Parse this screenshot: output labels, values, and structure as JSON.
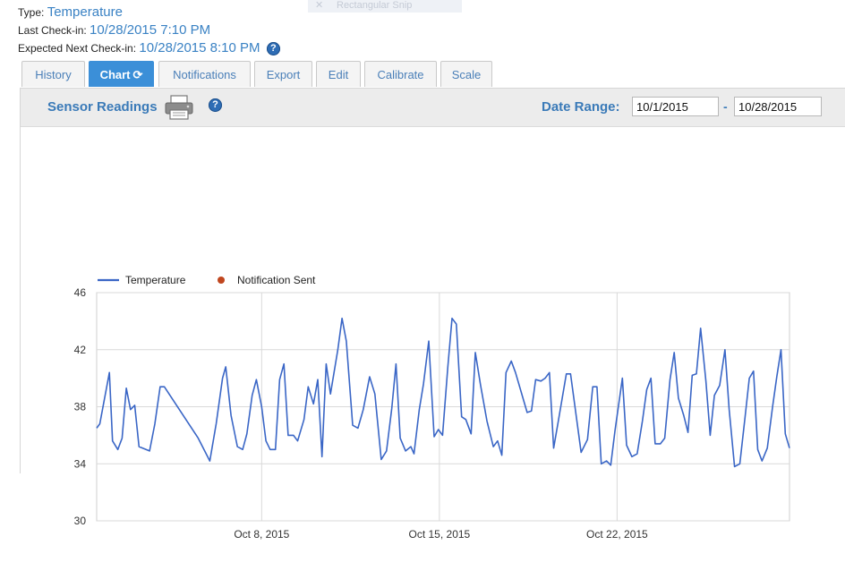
{
  "overlay": {
    "snip_label": "Rectangular Snip"
  },
  "sensor": {
    "type_label": "Type:",
    "type_value": "Temperature",
    "last_checkin_label": "Last Check-in:",
    "last_checkin_value": "10/28/2015 7:10 PM",
    "next_checkin_label": "Expected Next Check-in:",
    "next_checkin_value": "10/28/2015 8:10 PM"
  },
  "tabs": [
    {
      "label": "History"
    },
    {
      "label": "Chart",
      "active": true
    },
    {
      "label": "Notifications"
    },
    {
      "label": "Export"
    },
    {
      "label": "Edit"
    },
    {
      "label": "Calibrate"
    },
    {
      "label": "Scale"
    }
  ],
  "panel": {
    "title": "Sensor Readings",
    "date_range_label": "Date Range:",
    "date_from": "10/1/2015",
    "date_to": "10/28/2015",
    "dash": "-"
  },
  "icons": {
    "help": "help-icon",
    "refresh": "refresh-icon",
    "printer": "printer-icon"
  },
  "colors": {
    "series": "#3a66c6",
    "notification": "#c0461e",
    "link": "#3a82c4",
    "tab_active": "#3b8fd8"
  },
  "chart_data": {
    "type": "line",
    "x_type": "date",
    "x_ticks": [
      "Oct 8, 2015",
      "Oct 15, 2015",
      "Oct 22, 2015"
    ],
    "x_tick_dates": [
      "2015-10-08",
      "2015-10-15",
      "2015-10-22"
    ],
    "xlim": [
      "2015-10-01 12:00",
      "2015-10-28 19:00"
    ],
    "yticks": [
      30,
      34,
      38,
      42,
      46
    ],
    "ylim": [
      30,
      46
    ],
    "grid": true,
    "legend": "top-left",
    "series": [
      {
        "name": "Temperature",
        "points": [
          [
            "2015-10-01 12:00",
            36.5
          ],
          [
            "2015-10-01 15:00",
            36.8
          ],
          [
            "2015-10-02 00:00",
            40.4
          ],
          [
            "2015-10-02 03:00",
            35.6
          ],
          [
            "2015-10-02 08:00",
            35.0
          ],
          [
            "2015-10-02 12:00",
            35.8
          ],
          [
            "2015-10-02 16:00",
            39.3
          ],
          [
            "2015-10-02 20:00",
            37.8
          ],
          [
            "2015-10-03 00:00",
            38.1
          ],
          [
            "2015-10-03 04:00",
            35.2
          ],
          [
            "2015-10-03 14:00",
            34.9
          ],
          [
            "2015-10-03 19:00",
            36.8
          ],
          [
            "2015-10-04 00:00",
            39.4
          ],
          [
            "2015-10-04 04:00",
            39.4
          ],
          [
            "2015-10-05 12:00",
            35.8
          ],
          [
            "2015-10-05 23:00",
            34.2
          ],
          [
            "2015-10-06 05:00",
            36.8
          ],
          [
            "2015-10-06 11:00",
            40.0
          ],
          [
            "2015-10-06 14:00",
            40.8
          ],
          [
            "2015-10-06 19:00",
            37.4
          ],
          [
            "2015-10-07 01:00",
            35.2
          ],
          [
            "2015-10-07 06:00",
            35.0
          ],
          [
            "2015-10-07 10:00",
            36.1
          ],
          [
            "2015-10-07 15:00",
            38.8
          ],
          [
            "2015-10-07 19:00",
            39.9
          ],
          [
            "2015-10-08 00:00",
            38.0
          ],
          [
            "2015-10-08 04:00",
            35.6
          ],
          [
            "2015-10-08 08:00",
            35.0
          ],
          [
            "2015-10-08 13:00",
            35.0
          ],
          [
            "2015-10-08 17:00",
            39.9
          ],
          [
            "2015-10-08 21:00",
            41.0
          ],
          [
            "2015-10-09 01:00",
            36.0
          ],
          [
            "2015-10-09 06:00",
            36.0
          ],
          [
            "2015-10-09 10:00",
            35.6
          ],
          [
            "2015-10-09 16:00",
            37.1
          ],
          [
            "2015-10-09 20:00",
            39.4
          ],
          [
            "2015-10-10 01:00",
            38.2
          ],
          [
            "2015-10-10 05:00",
            39.9
          ],
          [
            "2015-10-10 09:00",
            34.5
          ],
          [
            "2015-10-10 13:00",
            41.0
          ],
          [
            "2015-10-10 17:00",
            38.9
          ],
          [
            "2015-10-11 00:00",
            42.0
          ],
          [
            "2015-10-11 04:00",
            44.2
          ],
          [
            "2015-10-11 08:00",
            42.6
          ],
          [
            "2015-10-11 14:00",
            36.7
          ],
          [
            "2015-10-11 19:00",
            36.5
          ],
          [
            "2015-10-12 00:00",
            37.8
          ],
          [
            "2015-10-12 06:00",
            40.1
          ],
          [
            "2015-10-12 11:00",
            38.9
          ],
          [
            "2015-10-12 17:00",
            34.3
          ],
          [
            "2015-10-12 22:00",
            34.9
          ],
          [
            "2015-10-13 03:00",
            37.9
          ],
          [
            "2015-10-13 07:00",
            41.0
          ],
          [
            "2015-10-13 11:00",
            35.8
          ],
          [
            "2015-10-13 16:00",
            34.9
          ],
          [
            "2015-10-13 21:00",
            35.2
          ],
          [
            "2015-10-14 00:00",
            34.7
          ],
          [
            "2015-10-14 05:00",
            37.8
          ],
          [
            "2015-10-14 09:00",
            39.6
          ],
          [
            "2015-10-14 14:00",
            42.6
          ],
          [
            "2015-10-14 19:00",
            35.9
          ],
          [
            "2015-10-14 23:00",
            36.4
          ],
          [
            "2015-10-15 03:00",
            36.0
          ],
          [
            "2015-10-15 08:00",
            40.8
          ],
          [
            "2015-10-15 12:00",
            44.2
          ],
          [
            "2015-10-15 16:00",
            43.8
          ],
          [
            "2015-10-15 21:00",
            37.3
          ],
          [
            "2015-10-16 01:00",
            37.1
          ],
          [
            "2015-10-16 06:00",
            36.1
          ],
          [
            "2015-10-16 10:00",
            41.8
          ],
          [
            "2015-10-16 15:00",
            39.5
          ],
          [
            "2015-10-16 21:00",
            37.0
          ],
          [
            "2015-10-17 03:00",
            35.2
          ],
          [
            "2015-10-17 07:00",
            35.6
          ],
          [
            "2015-10-17 11:00",
            34.6
          ],
          [
            "2015-10-17 15:00",
            40.4
          ],
          [
            "2015-10-17 20:00",
            41.2
          ],
          [
            "2015-10-18 00:00",
            40.4
          ],
          [
            "2015-10-18 11:00",
            37.6
          ],
          [
            "2015-10-18 15:00",
            37.7
          ],
          [
            "2015-10-18 19:00",
            39.9
          ],
          [
            "2015-10-19 00:00",
            39.8
          ],
          [
            "2015-10-19 04:00",
            40.0
          ],
          [
            "2015-10-19 08:00",
            40.4
          ],
          [
            "2015-10-19 12:00",
            35.1
          ],
          [
            "2015-10-19 16:00",
            36.8
          ],
          [
            "2015-10-20 00:00",
            40.3
          ],
          [
            "2015-10-20 04:00",
            40.3
          ],
          [
            "2015-10-20 14:00",
            34.8
          ],
          [
            "2015-10-20 20:00",
            35.7
          ],
          [
            "2015-10-21 01:00",
            39.4
          ],
          [
            "2015-10-21 05:00",
            39.4
          ],
          [
            "2015-10-21 09:00",
            34.0
          ],
          [
            "2015-10-21 14:00",
            34.2
          ],
          [
            "2015-10-21 18:00",
            33.9
          ],
          [
            "2015-10-21 22:00",
            36.3
          ],
          [
            "2015-10-22 05:00",
            40.0
          ],
          [
            "2015-10-22 09:00",
            35.3
          ],
          [
            "2015-10-22 14:00",
            34.5
          ],
          [
            "2015-10-22 19:00",
            34.7
          ],
          [
            "2015-10-23 00:00",
            37.0
          ],
          [
            "2015-10-23 04:00",
            39.2
          ],
          [
            "2015-10-23 08:00",
            40.0
          ],
          [
            "2015-10-23 12:00",
            35.4
          ],
          [
            "2015-10-23 17:00",
            35.4
          ],
          [
            "2015-10-23 21:00",
            35.8
          ],
          [
            "2015-10-24 02:00",
            39.9
          ],
          [
            "2015-10-24 06:00",
            41.8
          ],
          [
            "2015-10-24 10:00",
            38.6
          ],
          [
            "2015-10-24 15:00",
            37.4
          ],
          [
            "2015-10-24 19:00",
            36.2
          ],
          [
            "2015-10-24 23:00",
            40.2
          ],
          [
            "2015-10-25 03:00",
            40.3
          ],
          [
            "2015-10-25 07:00",
            43.5
          ],
          [
            "2015-10-25 12:00",
            39.8
          ],
          [
            "2015-10-25 16:00",
            36.0
          ],
          [
            "2015-10-25 20:00",
            38.8
          ],
          [
            "2015-10-26 01:00",
            39.5
          ],
          [
            "2015-10-26 06:00",
            42.0
          ],
          [
            "2015-10-26 10:00",
            37.8
          ],
          [
            "2015-10-26 15:00",
            33.8
          ],
          [
            "2015-10-26 20:00",
            34.0
          ],
          [
            "2015-10-27 01:00",
            37.3
          ],
          [
            "2015-10-27 05:00",
            40.0
          ],
          [
            "2015-10-27 09:00",
            40.5
          ],
          [
            "2015-10-27 13:00",
            35.0
          ],
          [
            "2015-10-27 17:00",
            34.2
          ],
          [
            "2015-10-27 22:00",
            35.1
          ],
          [
            "2015-10-28 03:00",
            38.0
          ],
          [
            "2015-10-28 07:00",
            40.1
          ],
          [
            "2015-10-28 11:00",
            42.0
          ],
          [
            "2015-10-28 15:00",
            36.1
          ],
          [
            "2015-10-28 19:00",
            35.1
          ]
        ]
      },
      {
        "name": "Notification Sent",
        "points": []
      }
    ]
  }
}
